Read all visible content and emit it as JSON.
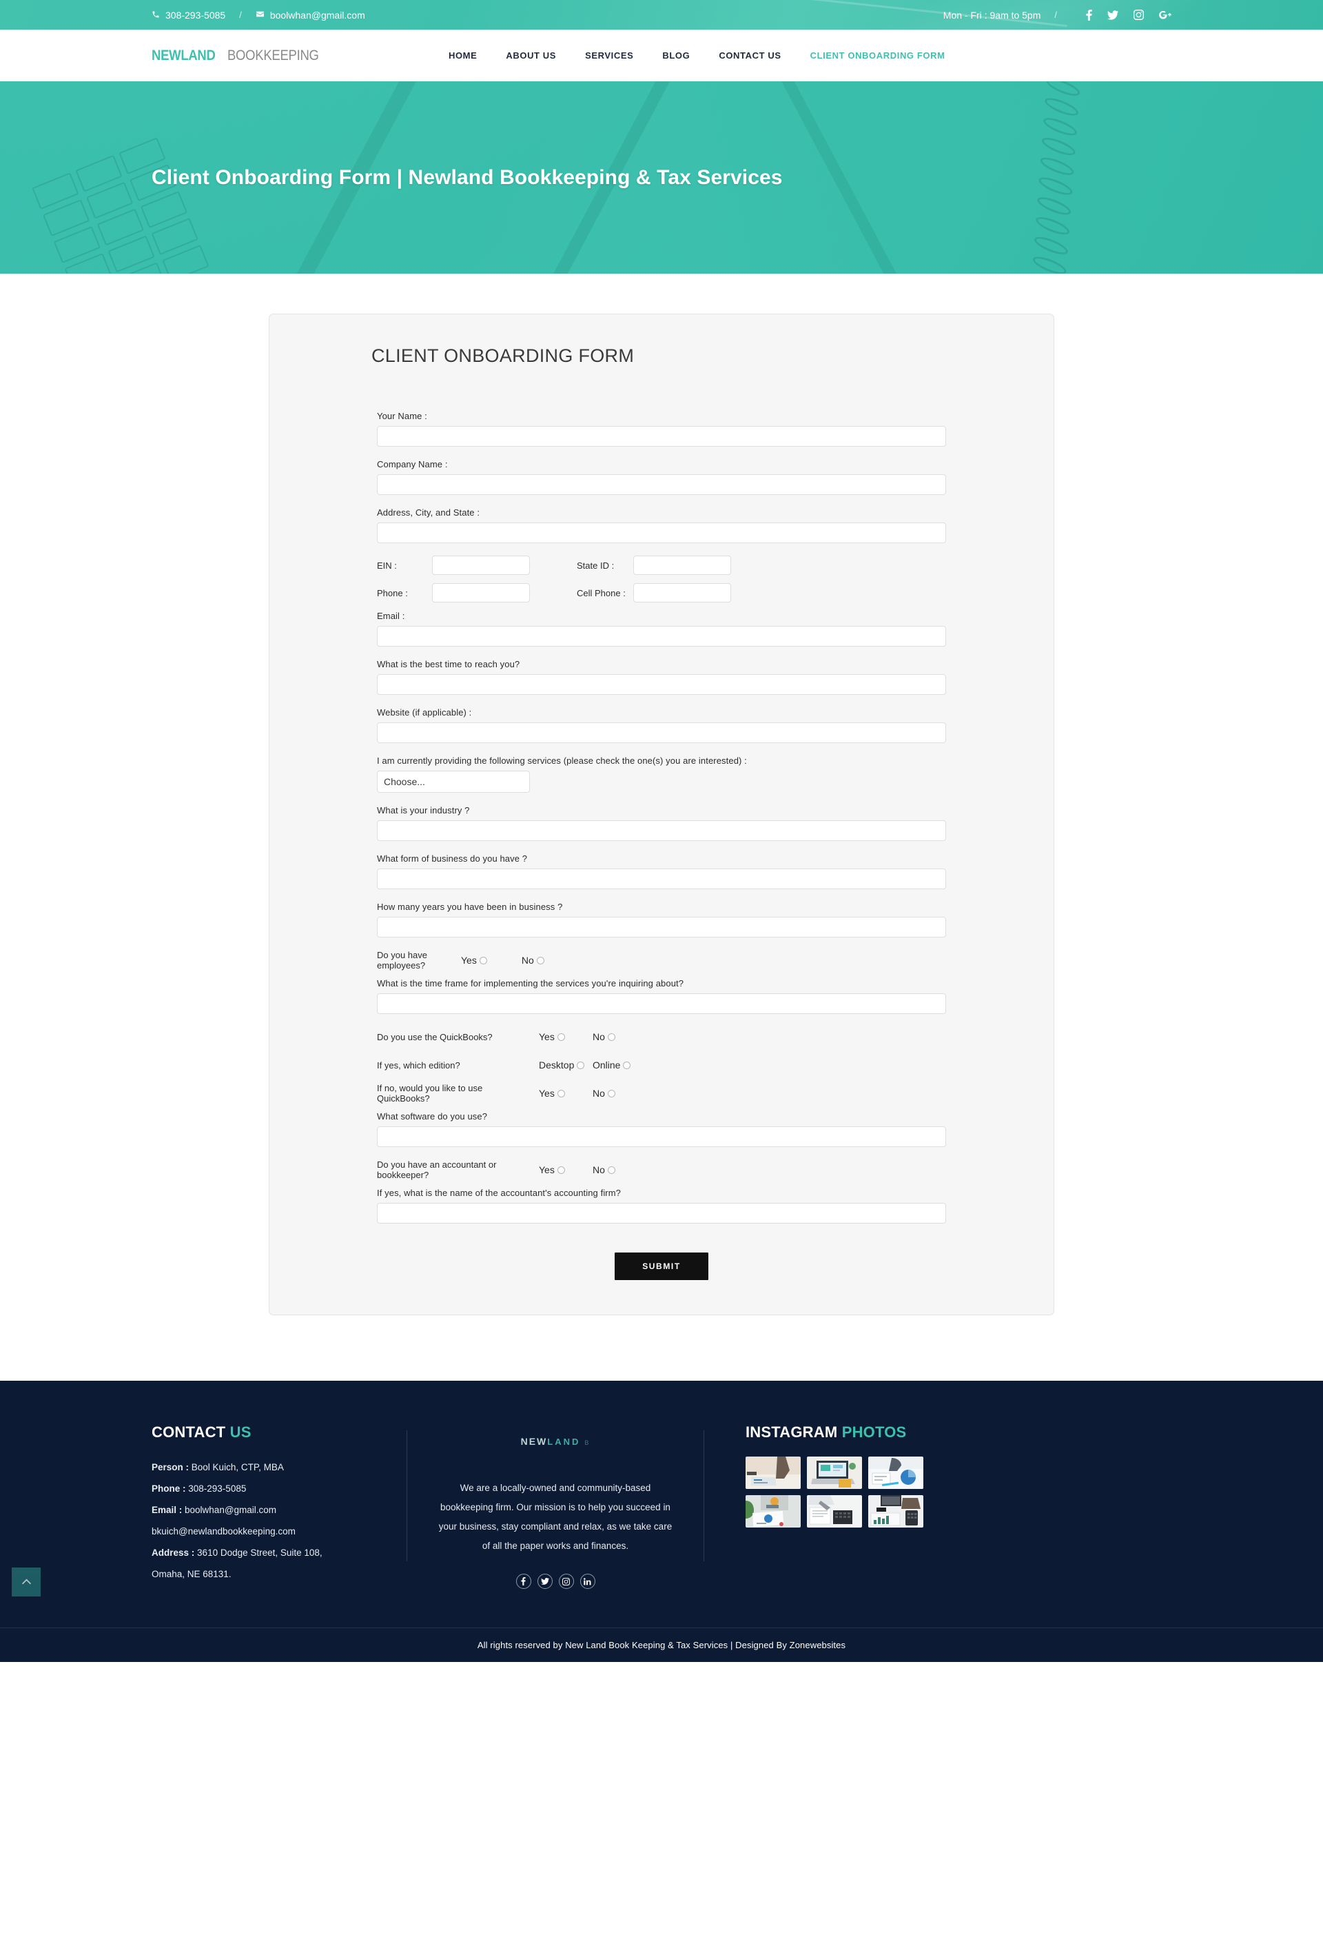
{
  "topbar": {
    "phone": "308-293-5085",
    "email": "boolwhan@gmail.com",
    "hours": "Mon - Fri : 9am to 5pm",
    "separator": "/",
    "socials": [
      "facebook-icon",
      "twitter-icon",
      "instagram-icon",
      "google-plus-icon"
    ]
  },
  "header": {
    "logo_part1": "NEWLAND",
    "logo_part2": "BOOKKEEPING",
    "nav": [
      {
        "label": "HOME",
        "active": false
      },
      {
        "label": "ABOUT US",
        "active": false
      },
      {
        "label": "SERVICES",
        "active": false
      },
      {
        "label": "BLOG",
        "active": false
      },
      {
        "label": "CONTACT US",
        "active": false
      },
      {
        "label": "CLIENT ONBOARDING FORM",
        "active": true
      }
    ]
  },
  "hero": {
    "title": "Client Onboarding Form | Newland Bookkeeping & Tax Services"
  },
  "form": {
    "heading": "CLIENT ONBOARDING FORM",
    "your_name_label": "Your Name :",
    "company_name_label": "Company Name :",
    "address_label": "Address, City, and State :",
    "ein_label": "EIN :",
    "state_id_label": "State ID :",
    "phone_label": "Phone :",
    "cell_phone_label": "Cell Phone :",
    "email_label": "Email :",
    "best_time_label": "What is the best time to reach you?",
    "website_label": "Website (if applicable) :",
    "services_label": "I am currently providing the following services (please check the one(s) you are interested) :",
    "services_selected": "Choose...",
    "industry_label": "What is your industry ?",
    "business_form_label": "What form of business do you have ?",
    "years_label": "How many years you have been in business ?",
    "employees_label": "Do you have employees?",
    "employees_yes": "Yes",
    "employees_no": "No",
    "timeframe_label": "What is the time frame for implementing the services you're inquiring about?",
    "quickbooks_label": "Do you use the QuickBooks?",
    "quickbooks_yes": "Yes",
    "quickbooks_no": "No",
    "edition_label": "If yes, which edition?",
    "edition_desktop": "Desktop",
    "edition_online": "Online",
    "use_qb_label": "If no, would you like to use QuickBooks?",
    "use_qb_yes": "Yes",
    "use_qb_no": "No",
    "software_label": "What software do you use?",
    "accountant_label": "Do you have an accountant or bookkeeper?",
    "accountant_yes": "Yes",
    "accountant_no": "No",
    "firm_label": "If yes, what is the name of the accountant's accounting firm?",
    "submit_label": "SUBMIT",
    "values": {
      "your_name": "",
      "company_name": "",
      "address": "",
      "ein": "",
      "state_id": "",
      "phone": "",
      "cell_phone": "",
      "email": "",
      "best_time": "",
      "website": "",
      "industry": "",
      "business_form": "",
      "years": "",
      "timeframe": "",
      "software": "",
      "firm": ""
    }
  },
  "footer": {
    "contact_heading_main": "CONTACT",
    "contact_heading_accent": "US",
    "person_label": "Person :",
    "person_value": "Bool Kuich, CTP, MBA",
    "phone_label": "Phone :",
    "phone_value": "308-293-5085",
    "email_label": "Email :",
    "email_value": "boolwhan@gmail.com",
    "email_value2": "bkuich@newlandbookkeeping.com",
    "address_label": "Address :",
    "address_value": "3610 Dodge Street, Suite 108,",
    "address_value2": "Omaha, NE 68131.",
    "logo_a": "NEW",
    "logo_b": "LAND",
    "logo_c": "B",
    "about_text": "We are a locally-owned and community-based bookkeeping firm. Our mission is to help you succeed in your business, stay compliant and relax, as we take care of all the paper works and finances.",
    "socials": [
      "facebook-icon",
      "twitter-icon",
      "instagram-icon",
      "linkedin-icon"
    ],
    "instagram_heading_main": "INSTAGRAM",
    "instagram_heading_accent": "PHOTOS",
    "instagram_count": 6,
    "copyright": "All rights reserved by New Land Book Keeping & Tax Services | Designed By Zonewebsites",
    "scroll_top_icon": "chevron-up-icon"
  },
  "colors": {
    "teal": "#3fc0ad",
    "navy": "#0c1a33",
    "dark_button": "#111111",
    "card_bg": "#f6f6f6"
  }
}
